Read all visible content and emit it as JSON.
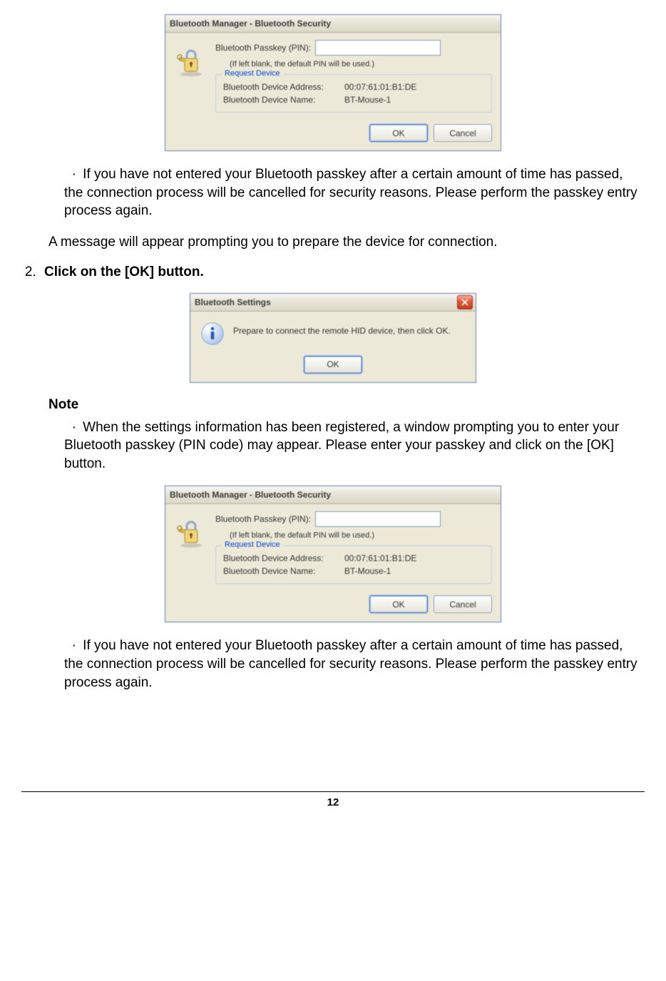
{
  "dialog_security": {
    "title": "Bluetooth Manager - Bluetooth Security",
    "passkey_label": "Bluetooth Passkey (PIN):",
    "passkey_value": "",
    "hint": "(If left blank, the default PIN will be used.)",
    "groupbox_title": "Request Device",
    "addr_label": "Bluetooth Device Address:",
    "addr_value": "00:07:61:01:B1:DE",
    "name_label": "Bluetooth Device Name:",
    "name_value": "BT-Mouse-1",
    "ok": "OK",
    "cancel": "Cancel"
  },
  "dialog_settings": {
    "title": "Bluetooth Settings",
    "message": "Prepare to connect the remote HID device, then click OK.",
    "ok": "OK"
  },
  "text": {
    "bullet": "·",
    "timeout_note": "If you have not entered your Bluetooth passkey after a certain amount of time has passed, the connection process will be cancelled for security reasons. Please perform the passkey entry process again.",
    "prompt_msg": "A message will appear prompting you to prepare the device for connection.",
    "step_num": "2.",
    "step_text": "Click on the [OK] button.",
    "note_label": "Note",
    "note_body": "When the settings information has been registered, a window prompting you to enter your Bluetooth passkey (PIN code) may appear. Please enter your passkey and click on the [OK] button."
  },
  "page_number": "12"
}
